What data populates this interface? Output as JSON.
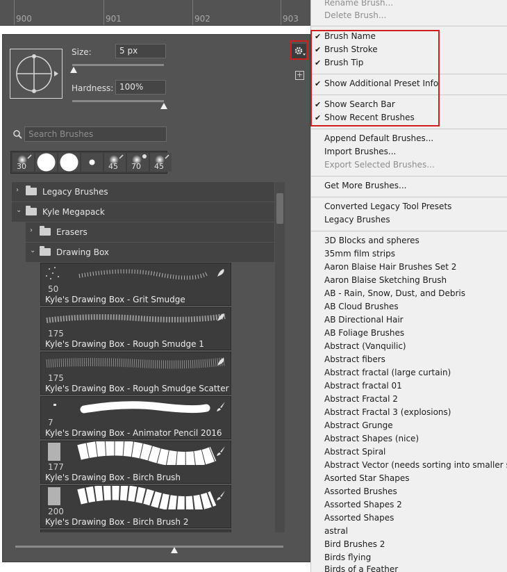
{
  "ruler": {
    "labels": [
      "900",
      "901",
      "902",
      "903"
    ]
  },
  "brush_settings": {
    "size_label": "Size:",
    "size_value": "5 px",
    "hardness_label": "Hardness:",
    "hardness_value": "100%"
  },
  "search": {
    "placeholder": "Search Brushes"
  },
  "recent_brushes": [
    "30",
    "",
    "",
    "",
    "45",
    "70",
    "45"
  ],
  "groups": {
    "legacy": "Legacy Brushes",
    "kyle": "Kyle Megapack",
    "erasers": "Erasers",
    "drawing_box": "Drawing Box"
  },
  "brushes": [
    {
      "size": "50",
      "name": "Kyle's Drawing Box - Grit Smudge"
    },
    {
      "size": "175",
      "name": "Kyle's Drawing Box - Rough Smudge 1"
    },
    {
      "size": "175",
      "name": "Kyle's Drawing Box - Rough Smudge Scatter"
    },
    {
      "size": "7",
      "name": "Kyle's Drawing Box - Animator Pencil 2016"
    },
    {
      "size": "177",
      "name": "Kyle's Drawing Box - Birch Brush"
    },
    {
      "size": "200",
      "name": "Kyle's Drawing Box - Birch Brush 2"
    }
  ],
  "menu": {
    "top": [
      "Rename Brush...",
      "Delete Brush..."
    ],
    "view1": [
      "Brush Name",
      "Brush Stroke",
      "Brush Tip"
    ],
    "view2": [
      "Show Additional Preset Info"
    ],
    "view3": [
      "Show Search Bar",
      "Show Recent Brushes"
    ],
    "file": [
      "Append Default Brushes...",
      "Import Brushes...",
      "Export Selected Brushes..."
    ],
    "more": [
      "Get More Brushes..."
    ],
    "converted": [
      "Converted Legacy Tool Presets",
      "Legacy Brushes"
    ],
    "libraries": [
      "3D Blocks and spheres",
      "35mm film strips",
      "Aaron Blaise Hair Brushes Set 2",
      "Aaron Blaise Sketching Brush",
      "AB - Rain, Snow, Dust, and Debris",
      "AB Cloud Brushes",
      "AB Directional Hair",
      "AB Foliage Brushes",
      "Abstract (Vanquilic)",
      "Abstract fibers",
      "Abstract fractal (large curtain)",
      "Abstract fractal 01",
      "Abstract Fractal 2",
      "Abstract Fractal 3 (explosions)",
      "Abstract Grunge",
      "Abstract Shapes (nice)",
      "Abstract Spiral",
      "Abstract Vector (needs sorting into smaller sets)",
      "Asorted Star Shapes",
      "Assorted Brushes",
      "Assorted Shapes 2",
      "Assorted Shapes",
      "astral",
      "Bird Brushes 2",
      "Birds flying",
      "Birds of a Feather"
    ]
  }
}
